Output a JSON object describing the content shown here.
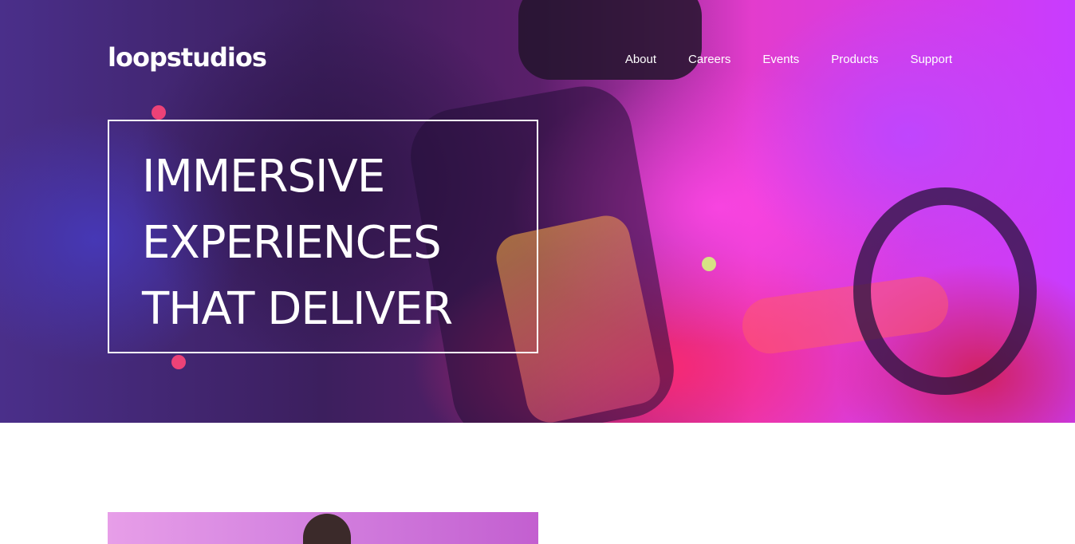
{
  "brand": {
    "logo_text": "loopstudios"
  },
  "nav": {
    "links": [
      {
        "label": "About"
      },
      {
        "label": "Careers"
      },
      {
        "label": "Events"
      },
      {
        "label": "Products"
      },
      {
        "label": "Support"
      }
    ]
  },
  "hero": {
    "headline_lines": [
      "IMMERSIVE",
      "EXPERIENCES",
      "THAT DELIVER"
    ]
  },
  "colors": {
    "text": "#ffffff",
    "page_background": "#ffffff"
  }
}
